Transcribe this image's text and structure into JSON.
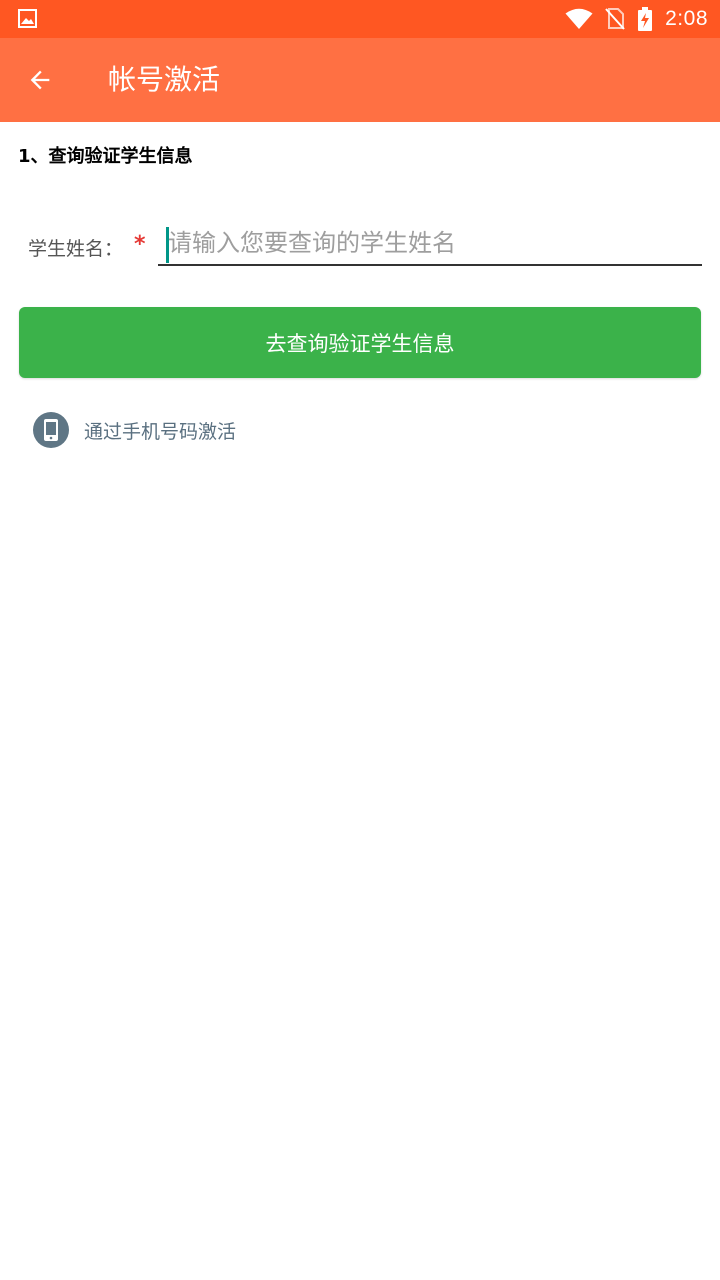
{
  "status_bar": {
    "time": "2:08",
    "icons": [
      "image-notification-icon",
      "wifi-icon",
      "no-sim-icon",
      "battery-charging-icon"
    ]
  },
  "app_bar": {
    "back_icon": "arrow-back-icon",
    "title": "帐号激活"
  },
  "section": {
    "title": "1、查询验证学生信息"
  },
  "form": {
    "name_label": "学生姓名：",
    "required_mark": "*",
    "name_value": "",
    "name_placeholder": "请输入您要查询的学生姓名"
  },
  "actions": {
    "submit_label": "去查询验证学生信息",
    "phone_link_label": "通过手机号码激活",
    "phone_icon": "smartphone-icon"
  },
  "colors": {
    "status_bar": "#ff5722",
    "app_bar": "#ff7043",
    "primary_button": "#3bb24a",
    "required": "#e53935",
    "caret": "#009688",
    "link_text": "#5a7080"
  }
}
